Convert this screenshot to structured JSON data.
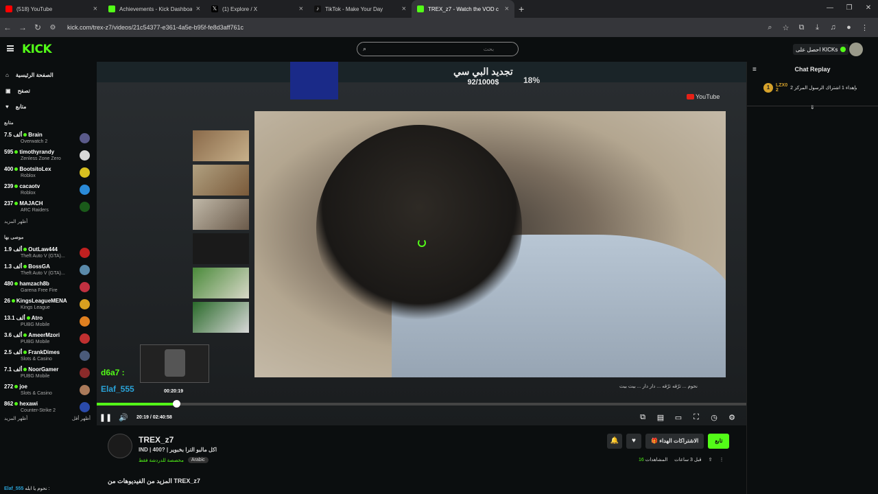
{
  "browser": {
    "tabs": [
      {
        "title": "(518) YouTube",
        "color": "#ff0000"
      },
      {
        "title": "Achievements - Kick Dashboard",
        "color": "#53fc18"
      },
      {
        "title": "(1) Explore / X",
        "color": "#ffffff"
      },
      {
        "title": "TikTok - Make Your Day",
        "color": "#ffffff"
      },
      {
        "title": "TREX_z7 - Watch the VOD c",
        "color": "#53fc18"
      }
    ],
    "url": "kick.com/trex-z7/videos/21c54377-e361-4a5e-b95f-fe8d3aff761c"
  },
  "header": {
    "logo": "KICK",
    "search_placeholder": "بحث",
    "kicks_button": "احصل على KICKs"
  },
  "sidebar": {
    "nav": [
      {
        "label": "الصفحة الرئيسية",
        "icon": "home-icon"
      },
      {
        "label": "تصفح",
        "icon": "browse-icon"
      },
      {
        "label": "متابع",
        "icon": "heart-icon"
      }
    ],
    "following_title": "متابع",
    "following": [
      {
        "count": "7.5 ألف",
        "name": "Brain",
        "category": "Overwatch 2",
        "color": "#5a5a8a"
      },
      {
        "count": "595",
        "name": "timothyrandy",
        "category": "Zenless Zone Zero",
        "color": "#d8d8d8"
      },
      {
        "count": "400",
        "name": "BootsitoLex",
        "category": "Roblox",
        "color": "#d8c020"
      },
      {
        "count": "239",
        "name": "cacaotv",
        "category": "Roblox",
        "color": "#2a8ad8"
      },
      {
        "count": "237",
        "name": "MAJACH",
        "category": "ARC Raiders",
        "color": "#1a5a1a"
      }
    ],
    "show_more": "أظهر المزيد",
    "recommended_title": "موصى بها",
    "recommended": [
      {
        "count": "1.9 ألف",
        "name": "OutLaw444",
        "category": "Theft Auto V (GTA)...",
        "color": "#c02020"
      },
      {
        "count": "1.3 ألف",
        "name": "BossGA",
        "category": "Theft Auto V (GTA)...",
        "color": "#5a8aaa"
      },
      {
        "count": "480",
        "name": "hamzach8b",
        "category": "Garena Free Fire",
        "color": "#c03040"
      },
      {
        "count": "26",
        "name": "KingsLeagueMENA",
        "category": "Kings League",
        "color": "#d8a020"
      },
      {
        "count": "13.1 ألف",
        "name": "Atro",
        "category": "PUBG Mobile",
        "color": "#e08020"
      },
      {
        "count": "3.6 ألف",
        "name": "AmeerMzori",
        "category": "PUBG Mobile",
        "color": "#c03030"
      },
      {
        "count": "2.5 ألف",
        "name": "FrankDimes",
        "category": "Slots & Casino",
        "color": "#4a5a7a"
      },
      {
        "count": "7.1 ألف",
        "name": "NoorGamer",
        "category": "PUBG Mobile",
        "color": "#8a2a2a"
      },
      {
        "count": "272",
        "name": "joe",
        "category": "Slots & Casino",
        "color": "#aa7a5a"
      },
      {
        "count": "862",
        "name": "hexawi",
        "category": "Counter-Strike 2",
        "color": "#2a4aaa"
      }
    ],
    "show_more_2": "أظهر المزيد",
    "show_less": "أظهر أقل"
  },
  "player": {
    "overlay_title": "تجديد البي سي",
    "overlay_amount": "92/1000$",
    "overlay_percent": "18%",
    "yt_label": "YouTube",
    "caption": "نحوم ... ترّقه ترّقه ... دار دار ... بيت بيت",
    "preview_time": "00:20:19",
    "left_text_1": "d6a7 :",
    "left_text_2": "Elaf_555",
    "progress": 0.123,
    "current_time": "20:19",
    "duration": "02:40:58"
  },
  "chat": {
    "title": "Chat Replay",
    "msg_user": "LZX0",
    "msg_badge": "2",
    "msg_text": "بإهداء 1 اشتراك الرسول المركز 2"
  },
  "channel": {
    "name": "TREX_z7",
    "title": "IND | 400? | اكل مالبو الترا بخبوير",
    "subtitle": "مخصصة للدردشة فقط",
    "language": "Arabic",
    "follow_label": "تابع",
    "subs_label": "الاشتراكات الهداء",
    "views_label": "المشاهدات",
    "views_count": "16",
    "time_ago": "قبل 3 ساعات",
    "more_videos": "المزيد من الفيديوهات من TREX_z7"
  },
  "bottom_chat": {
    "user": "Elaf_555",
    "text": "نحوم يا ابله :"
  }
}
